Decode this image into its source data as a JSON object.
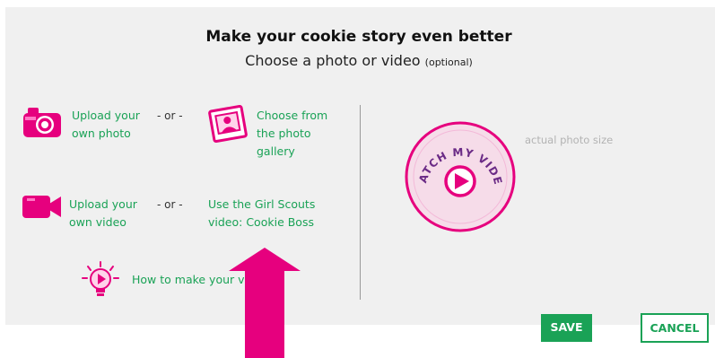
{
  "dialog": {
    "title": "Make your cookie story even better",
    "subtitle": "Choose a photo or video",
    "subtitle_optional": "(optional)"
  },
  "photo_options": {
    "upload_line1": "Upload your",
    "upload_line2": "own photo",
    "or": "- or -",
    "gallery_line1": "Choose from",
    "gallery_line2": "the photo",
    "gallery_line3": "gallery"
  },
  "video_options": {
    "upload_line1": "Upload your",
    "upload_line2": "own video",
    "or": "- or -",
    "gs_line1": "Use the Girl Scouts",
    "gs_line2": "video: Cookie Boss"
  },
  "howto": {
    "label": "How to make your v"
  },
  "preview": {
    "badge_text": "WATCH MY VIDEO",
    "hint": "actual photo size"
  },
  "buttons": {
    "save": "SAVE",
    "cancel": "CANCEL"
  },
  "colors": {
    "accent_green": "#1aa256",
    "pink": "#e6007e",
    "panel": "#f0f0f0"
  },
  "icons": [
    "camera-icon",
    "photo-gallery-icon",
    "video-camera-icon",
    "lightbulb-play-icon",
    "play-icon",
    "arrow-up-icon"
  ]
}
